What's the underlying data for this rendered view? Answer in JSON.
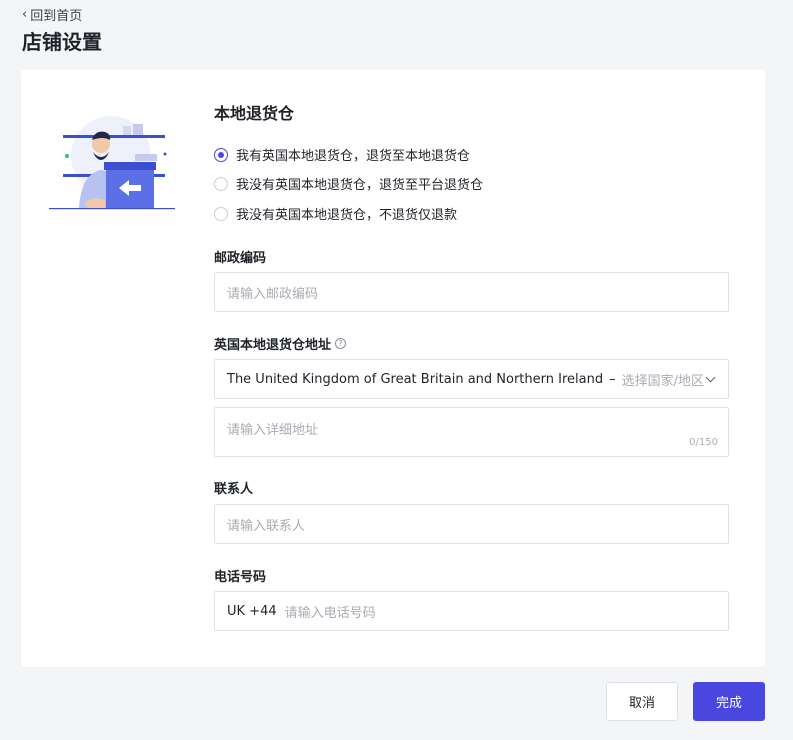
{
  "header": {
    "back_label": "回到首页",
    "title": "店铺设置"
  },
  "section": {
    "title": "本地退货仓",
    "options": [
      {
        "label": "我有英国本地退货仓，退货至本地退货仓",
        "checked": true
      },
      {
        "label": "我没有英国本地退货仓，退货至平台退货仓",
        "checked": false
      },
      {
        "label": "我没有英国本地退货仓，不退货仅退款",
        "checked": false
      }
    ]
  },
  "postal": {
    "label": "邮政编码",
    "placeholder": "请输入邮政编码"
  },
  "address": {
    "label": "英国本地退货仓地址",
    "help": "?",
    "country": "The United Kingdom of Great Britain and Northern Ireland",
    "separator": "–",
    "region_placeholder": "选择国家/地区",
    "detail_placeholder": "请输入详细地址",
    "counter": "0/150"
  },
  "contact": {
    "label": "联系人",
    "placeholder": "请输入联系人"
  },
  "phone": {
    "label": "电话号码",
    "prefix": "UK +44",
    "placeholder": "请输入电话号码"
  },
  "actions": {
    "cancel": "取消",
    "done": "完成"
  },
  "colors": {
    "accent": "#4a46e0",
    "page_bg": "#f4f5f7"
  }
}
